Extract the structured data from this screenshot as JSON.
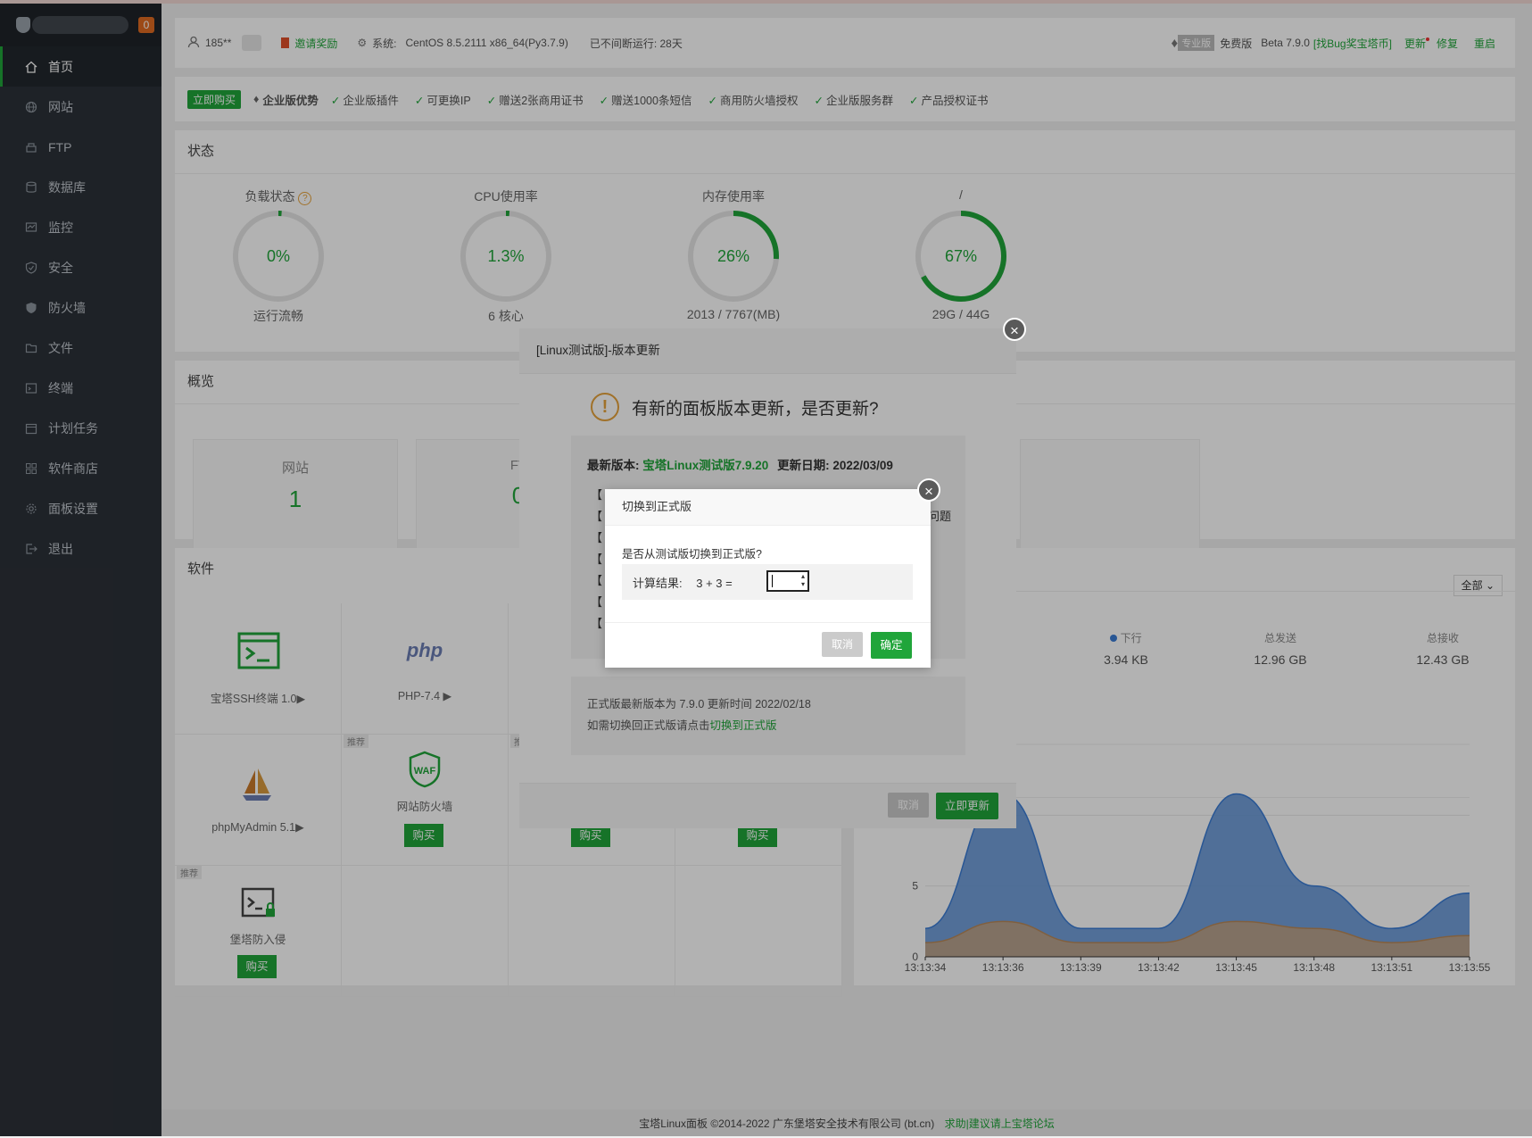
{
  "sidebar": {
    "badge": "0",
    "items": [
      {
        "label": "首页",
        "icon": "home-icon",
        "active": true
      },
      {
        "label": "网站",
        "icon": "globe-icon"
      },
      {
        "label": "FTP",
        "icon": "ftp-icon"
      },
      {
        "label": "数据库",
        "icon": "database-icon"
      },
      {
        "label": "监控",
        "icon": "monitor-icon"
      },
      {
        "label": "安全",
        "icon": "shield-check-icon"
      },
      {
        "label": "防火墙",
        "icon": "shield-icon"
      },
      {
        "label": "文件",
        "icon": "folder-icon"
      },
      {
        "label": "终端",
        "icon": "terminal-icon"
      },
      {
        "label": "计划任务",
        "icon": "calendar-icon"
      },
      {
        "label": "软件商店",
        "icon": "grid-icon"
      },
      {
        "label": "面板设置",
        "icon": "gear-icon"
      },
      {
        "label": "退出",
        "icon": "logout-icon"
      }
    ]
  },
  "header": {
    "user": "185**",
    "invite": "邀请奖励",
    "system_label": "系统:",
    "system_value": "CentOS 8.5.2111 x86_64(Py3.7.9)",
    "uptime": "已不间断运行: 28天",
    "pro_badge": "专业版",
    "edition": "免费版",
    "version": "Beta 7.9.0",
    "bug_link": "[找Bug奖宝塔币]",
    "update": "更新",
    "repair": "修复",
    "restart": "重启"
  },
  "promo": {
    "buy": "立即购买",
    "title": "企业版优势",
    "items": [
      "企业版插件",
      "可更换IP",
      "赠送2张商用证书",
      "赠送1000条短信",
      "商用防火墙授权",
      "企业版服务群",
      "产品授权证书"
    ]
  },
  "status": {
    "title": "状态",
    "gauges": [
      {
        "label": "负载状态",
        "value": "0%",
        "percent": 0,
        "sub": "运行流畅"
      },
      {
        "label": "CPU使用率",
        "value": "1.3%",
        "percent": 1.3,
        "sub": "6 核心"
      },
      {
        "label": "内存使用率",
        "value": "26%",
        "percent": 26,
        "sub": "2013 / 7767(MB)"
      },
      {
        "label": "/",
        "value": "67%",
        "percent": 67,
        "sub": "29G / 44G"
      }
    ]
  },
  "overview": {
    "title": "概览",
    "boxes": [
      {
        "label": "网站",
        "value": "1"
      },
      {
        "label": "FT",
        "value": "0"
      }
    ]
  },
  "software": {
    "title": "软件",
    "select": "全部",
    "tiles": [
      {
        "name": "宝塔SSH终端 1.0▶"
      },
      {
        "name": "PHP-7.4 ▶"
      },
      {
        "name": "phpMyAdmin 5.1▶"
      },
      {
        "name": "网站防火墙",
        "buy": "购买",
        "tag": "推荐"
      },
      {
        "buy": "购买"
      },
      {
        "buy": "购买"
      },
      {
        "name": "堡塔防入侵",
        "buy": "购买",
        "tag": "推荐"
      }
    ],
    "tag_extra": "推"
  },
  "traffic": {
    "down_label": "下行",
    "down_value": "3.94 KB",
    "sent_label": "总发送",
    "sent_value": "12.96 GB",
    "recv_label": "总接收",
    "recv_value": "12.43 GB"
  },
  "chart_data": {
    "type": "area",
    "x": [
      "13:13:34",
      "13:13:36",
      "13:13:39",
      "13:13:42",
      "13:13:45",
      "13:13:48",
      "13:13:51",
      "13:13:55"
    ],
    "yticks": [
      0,
      5,
      10
    ],
    "ylim": [
      0,
      15
    ],
    "series": [
      {
        "values": [
          2,
          11.5,
          2,
          2,
          11.5,
          5,
          2,
          4.5
        ],
        "color": "#5a8fd3"
      },
      {
        "values": [
          1,
          2.5,
          1,
          1,
          2.5,
          2,
          1,
          1.5
        ],
        "color": "#c9a27a"
      }
    ]
  },
  "update_dialog": {
    "title": "[Linux测试版]-版本更新",
    "question": "有新的面板版本更新，是否更新?",
    "latest_label": "最新版本:",
    "latest_value": "宝塔Linux测试版7.9.20",
    "date_label": "更新日期:",
    "date_value": "2022/03/09",
    "stable_line": "正式版最新版本为 7.9.0   更新时间  2022/02/18",
    "switch_prefix": "如需切换回正式版请点击",
    "switch_link": "切换到正式版",
    "cancel": "取消",
    "update_now": "立即更新",
    "note_tail": "问题"
  },
  "switch_dialog": {
    "title": "切换到正式版",
    "ask": "是否从测试版切换到正式版?",
    "calc_label": "计算结果:",
    "expr": "3 + 3  =",
    "cancel": "取消",
    "confirm": "确定"
  },
  "footer": {
    "copyright": "宝塔Linux面板 ©2014-2022 广东堡塔安全技术有限公司 (bt.cn)",
    "link": "求助|建议请上宝塔论坛"
  }
}
